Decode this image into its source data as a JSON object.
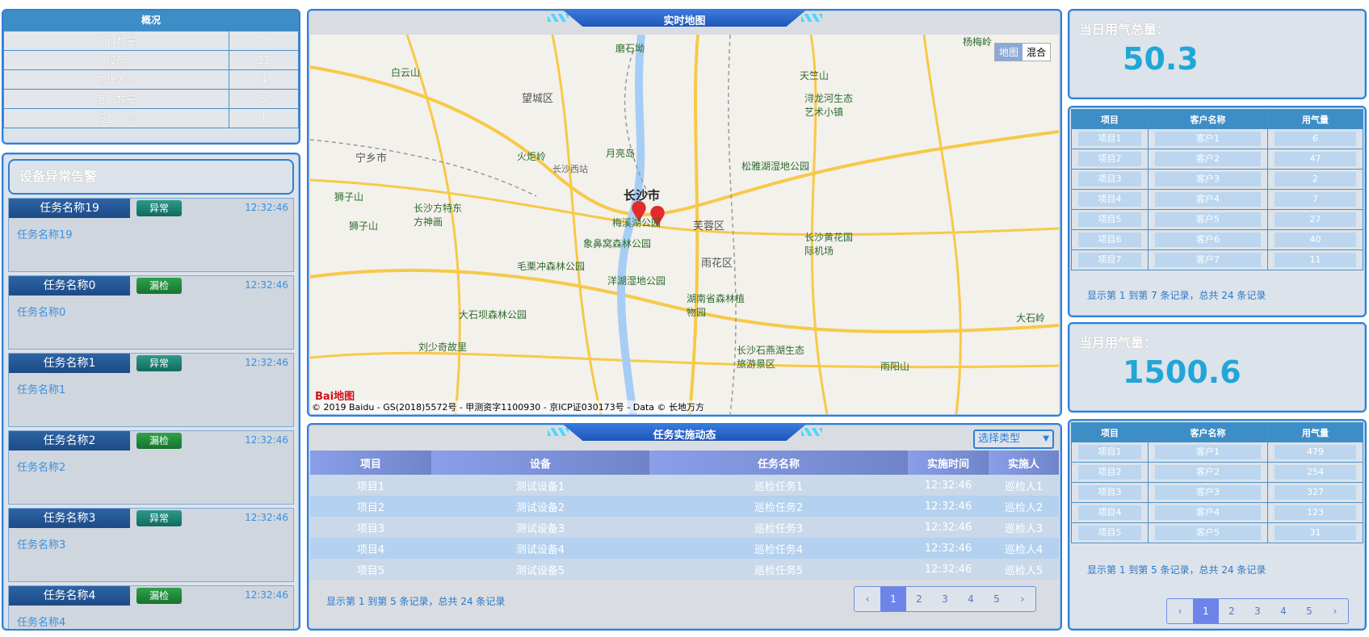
{
  "overview": {
    "title": "概况",
    "rows": [
      {
        "label": "项目数量",
        "value": "3"
      },
      {
        "label": "设备",
        "value": "15"
      },
      {
        "label": "管理人员",
        "value": "4"
      },
      {
        "label": "客户数量",
        "value": "5"
      },
      {
        "label": "设备厂商",
        "value": "1"
      }
    ]
  },
  "alerts": {
    "title": "设备异常告警",
    "items": [
      {
        "name": "任务名称19",
        "status": "异常",
        "type": "abn",
        "time": "12:32:46",
        "body": "任务名称19"
      },
      {
        "name": "任务名称0",
        "status": "漏检",
        "type": "miss",
        "time": "12:32:46",
        "body": "任务名称0"
      },
      {
        "name": "任务名称1",
        "status": "异常",
        "type": "abn",
        "time": "12:32:46",
        "body": "任务名称1"
      },
      {
        "name": "任务名称2",
        "status": "漏检",
        "type": "miss",
        "time": "12:32:46",
        "body": "任务名称2"
      },
      {
        "name": "任务名称3",
        "status": "异常",
        "type": "abn",
        "time": "12:32:46",
        "body": "任务名称3"
      },
      {
        "name": "任务名称4",
        "status": "漏检",
        "type": "miss",
        "time": "12:32:46",
        "body": "任务名称4"
      }
    ]
  },
  "map": {
    "title": "实时地图",
    "toggle_map": "地图",
    "toggle_mixed": "混合",
    "logo": "Bai地图",
    "copyright": "© 2019 Baidu - GS(2018)5572号 - 甲测资字1100930 - 京ICP证030173号 - Data © 长地万方",
    "city": "长沙市",
    "labels": {
      "l1": "磨石坳",
      "l2": "白云山",
      "l3": "望城区",
      "l4": "月亮岛",
      "l5": "天竺山",
      "l6": "浔龙河生态艺术小镇",
      "l7": "火炬岭",
      "l8": "长沙西站",
      "l9": "松雅湖湿地公园",
      "l10": "宁乡市",
      "l11": "狮子山",
      "l12": "长沙方特东方神画",
      "l13": "梅溪湖公园",
      "l14": "芙蓉区",
      "l15": "象鼻窝森林公园",
      "l16": "长沙黄花国际机场",
      "l17": "毛栗冲森林公园",
      "l18": "洋湖湿地公园",
      "l19": "雨花区",
      "l20": "湖南省森林植物园",
      "l21": "大石坝森林公园",
      "l22": "刘少奇故里",
      "l23": "长沙石燕湖生态旅游景区",
      "l24": "雨阳山",
      "l25": "大石岭",
      "l26": "杨梅岭",
      "l27": "狮子山"
    }
  },
  "tasks": {
    "title": "任务实施动态",
    "select_label": "选择类型",
    "columns": [
      "项目",
      "设备",
      "任务名称",
      "实施时间",
      "实施人"
    ],
    "rows": [
      [
        "项目1",
        "测试设备1",
        "巡检任务1",
        "12:32:46",
        "巡检人1"
      ],
      [
        "项目2",
        "测试设备2",
        "巡检任务2",
        "12:32:46",
        "巡检人2"
      ],
      [
        "项目3",
        "测试设备3",
        "巡检任务3",
        "12:32:46",
        "巡检人3"
      ],
      [
        "项目4",
        "测试设备4",
        "巡检任务4",
        "12:32:46",
        "巡检人4"
      ],
      [
        "项目5",
        "测试设备5",
        "巡检任务5",
        "12:32:46",
        "巡检人5"
      ]
    ],
    "page_info": "显示第 1 到第 5 条记录，总共 24 条记录",
    "pager": [
      "‹",
      "1",
      "2",
      "3",
      "4",
      "5",
      "›"
    ]
  },
  "daily": {
    "label": "当日用气总量：",
    "value": "50.3",
    "columns": [
      "项目",
      "客户名称",
      "用气量"
    ],
    "rows": [
      [
        "项目1",
        "客户1",
        "6"
      ],
      [
        "项目2",
        "客户2",
        "47"
      ],
      [
        "项目3",
        "客户3",
        "2"
      ],
      [
        "项目4",
        "客户4",
        "7"
      ],
      [
        "项目5",
        "客户5",
        "27"
      ],
      [
        "项目6",
        "客户6",
        "40"
      ],
      [
        "项目7",
        "客户7",
        "11"
      ]
    ],
    "page_info": "显示第 1 到第 7 条记录，总共 24 条记录"
  },
  "monthly": {
    "label": "当月用气量：",
    "value": "1500.6",
    "columns": [
      "项目",
      "客户名称",
      "用气量"
    ],
    "rows": [
      [
        "项目1",
        "客户1",
        "479"
      ],
      [
        "项目2",
        "客户2",
        "254"
      ],
      [
        "项目3",
        "客户3",
        "327"
      ],
      [
        "项目4",
        "客户4",
        "123"
      ],
      [
        "项目5",
        "客户5",
        "31"
      ]
    ],
    "page_info": "显示第 1 到第 5 条记录，总共 24 条记录",
    "pager": [
      "‹",
      "1",
      "2",
      "3",
      "4",
      "5",
      "›"
    ]
  }
}
